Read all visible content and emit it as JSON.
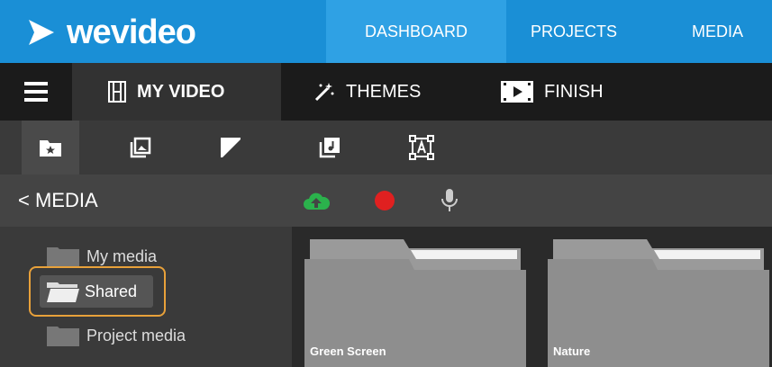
{
  "brand": {
    "logo_text": "wevideo",
    "accent": "#1a8fd6",
    "highlight": "#e8a13a"
  },
  "nav": {
    "dashboard": "DASHBOARD",
    "projects": "PROJECTS",
    "media": "MEDIA"
  },
  "modes": {
    "menu_icon": "hamburger-icon",
    "my_video": "MY VIDEO",
    "themes": "THEMES",
    "finish": "FINISH"
  },
  "tabs": [
    {
      "icon": "starred-folder-icon",
      "active": true
    },
    {
      "icon": "image-library-icon",
      "active": false
    },
    {
      "icon": "contrast-icon",
      "active": false
    },
    {
      "icon": "music-icon",
      "active": false
    },
    {
      "icon": "text-frame-icon",
      "active": false
    }
  ],
  "media_header": {
    "back_label": "< MEDIA",
    "actions": [
      {
        "icon": "cloud-upload-icon",
        "color": "#2bb24c"
      },
      {
        "icon": "record-icon",
        "color": "#e02020"
      },
      {
        "icon": "microphone-icon",
        "color": "#cccccc"
      }
    ]
  },
  "sidebar": {
    "items": [
      {
        "label": "My media"
      },
      {
        "label": "Shared",
        "selected": true
      },
      {
        "label": "Project media"
      }
    ]
  },
  "folders": [
    {
      "label": "Green Screen"
    },
    {
      "label": "Nature"
    }
  ]
}
